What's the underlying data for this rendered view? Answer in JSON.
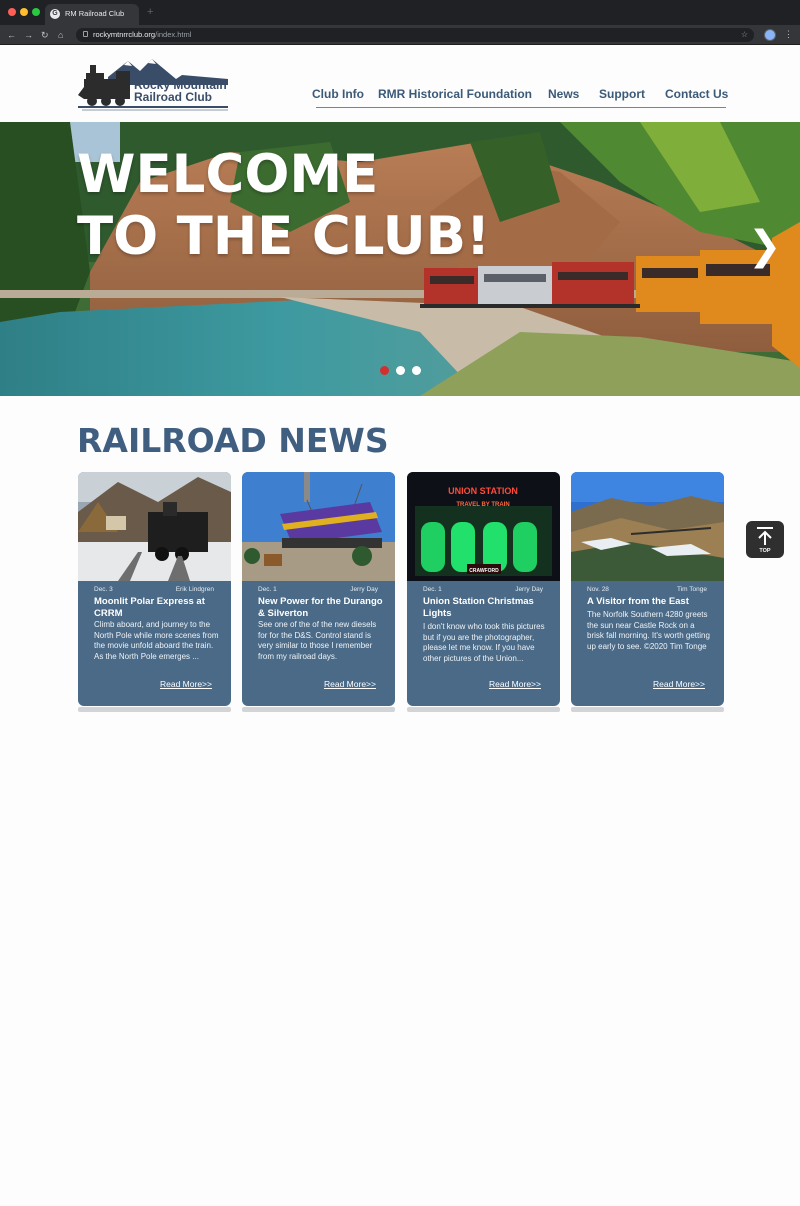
{
  "browser": {
    "tab_title": "RM Railroad Club",
    "tab_favicon": "G",
    "new_tab_icon": "+",
    "url_host": "rockymtnrrclub.org",
    "url_path": "/index.html",
    "icons": [
      "back-arrow-icon",
      "forward-arrow-icon",
      "reload-icon",
      "home-icon",
      "lock-icon",
      "bookmark-star-icon",
      "profile-avatar-icon",
      "menu-dots-icon"
    ]
  },
  "site": {
    "logo_line1": "Rocky Mountain",
    "logo_line2": "Railroad Club",
    "nav": [
      "Club Info",
      "RMR Historical Foundation",
      "News",
      "Support",
      "Contact Us"
    ]
  },
  "hero": {
    "title_line1": "WELCOME",
    "title_line2": "TO THE CLUB!",
    "next_glyph": "❯",
    "slide_count": 3,
    "active_slide": 1,
    "active_dot_color": "#d32f2f"
  },
  "news": {
    "heading": "RAILROAD NEWS",
    "read_more": "Read More>>",
    "cards": [
      {
        "date": "Dec. 3",
        "author": "Erik Lindgren",
        "title": "Moonlit Polar Express at CRRM",
        "body": "Climb aboard, and journey to the North Pole while more scenes from the movie unfold aboard the train. As the North Pole emerges ...",
        "image": "steam-locomotive-snow-photo"
      },
      {
        "date": "Dec. 1",
        "author": "Jerry Day",
        "title": "New Power for the Durango & Silverton",
        "body": "See one of the of the new diesels for for the D&S. Control stand is very similar to those I remember from my railroad days.",
        "image": "diesel-locomotive-crane-photo"
      },
      {
        "date": "Dec. 1",
        "author": "Jerry Day",
        "title": "Union Station Christmas Lights",
        "body": "I don't know who took this pictures but if you are the photographer, please let me know. If you have other pictures of the Union...",
        "image": "union-station-night-photo",
        "sign_line1": "UNION STATION",
        "sign_line2": "TRAVEL BY TRAIN",
        "sign_line3": "CRAWFORD"
      },
      {
        "date": "Nov. 28",
        "author": "Tim Tonge",
        "title": "A Visitor from the East",
        "body": "The Norfolk Southern 4280 greets the sun near Castle Rock on a brisk fall morning. It's worth getting up early to see. ©2020 Tim Tonge",
        "image": "train-valley-landscape-photo"
      }
    ]
  },
  "top_button": {
    "label": "TOP",
    "icon": "arrow-up-to-line-icon"
  },
  "colors": {
    "brand_blue": "#3f5e80",
    "card_bg": "#4a6a87",
    "nav_text": "#3b5a78"
  }
}
